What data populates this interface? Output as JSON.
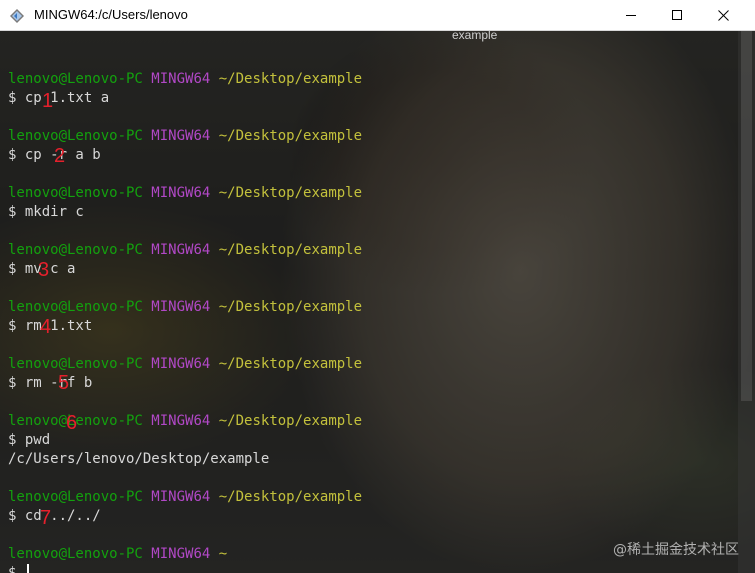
{
  "window": {
    "title": "MINGW64:/c/Users/lenovo",
    "ghost_caption": "example"
  },
  "prompt": {
    "user": "lenovo@Lenovo-PC",
    "host": "MINGW64",
    "path": "~/Desktop/example",
    "home_path": "~"
  },
  "commands": [
    "$ cp 1.txt a",
    "$ cp -r a b",
    "$ mkdir c",
    "$ mv c a",
    "$ rm 1.txt",
    "$ rm -rf b",
    "$ pwd",
    "$ cd ../../",
    "$ "
  ],
  "output": {
    "pwd_result": "/c/Users/lenovo/Desktop/example"
  },
  "annotations": [
    "1",
    "2",
    "3",
    "4",
    "5",
    "6",
    "7"
  ],
  "watermark": "@稀土掘金技术社区",
  "colors": {
    "user": "#13a10e",
    "host": "#b148c6",
    "path": "#c3c13c",
    "annotation": "#e4202c"
  }
}
